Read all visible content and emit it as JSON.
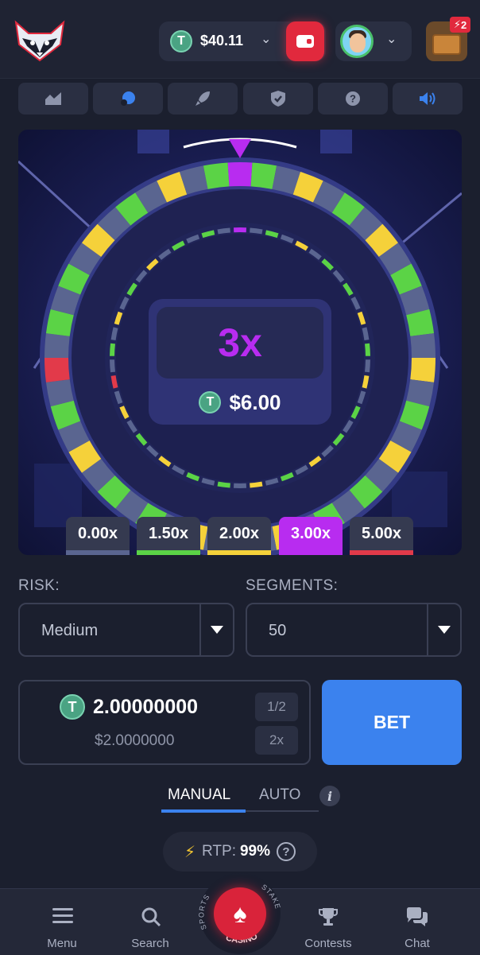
{
  "header": {
    "balance": "$40.11",
    "coin_symbol": "T",
    "chest_badge": "2"
  },
  "toolbar": {
    "items": [
      "stats-icon",
      "theme-icon",
      "rocket-icon",
      "shield-icon",
      "help-icon",
      "sound-icon"
    ]
  },
  "game": {
    "result_multiplier": "3x",
    "win_amount": "$6.00",
    "multipliers": [
      {
        "label": "0.00x",
        "color": "#5a6590"
      },
      {
        "label": "1.50x",
        "color": "#5bd346"
      },
      {
        "label": "2.00x",
        "color": "#f5d13a"
      },
      {
        "label": "3.00x",
        "color": "#b82cf0"
      },
      {
        "label": "5.00x",
        "color": "#e23a4a"
      }
    ],
    "active_multiplier": "3.00x"
  },
  "risk": {
    "label": "RISK:",
    "value": "Medium"
  },
  "segments": {
    "label": "SEGMENTS:",
    "value": "50"
  },
  "bet": {
    "amount": "2.00000000",
    "usd": "$2.0000000",
    "half_label": "1/2",
    "double_label": "2x",
    "button": "BET"
  },
  "tabs": {
    "manual": "MANUAL",
    "auto": "AUTO",
    "active": "MANUAL"
  },
  "rtp": {
    "label": "RTP:",
    "value": "99%"
  },
  "nav": {
    "menu": "Menu",
    "search": "Search",
    "casino": "CASINO",
    "ring_left": "SPORTS",
    "ring_right": "STAKE",
    "contests": "Contests",
    "chat": "Chat"
  },
  "colors": {
    "accent": "#3b82ee",
    "win": "#b82cf0",
    "green": "#5bd346",
    "yellow": "#f5d13a",
    "red": "#e23a4a",
    "grey": "#5a6590"
  }
}
